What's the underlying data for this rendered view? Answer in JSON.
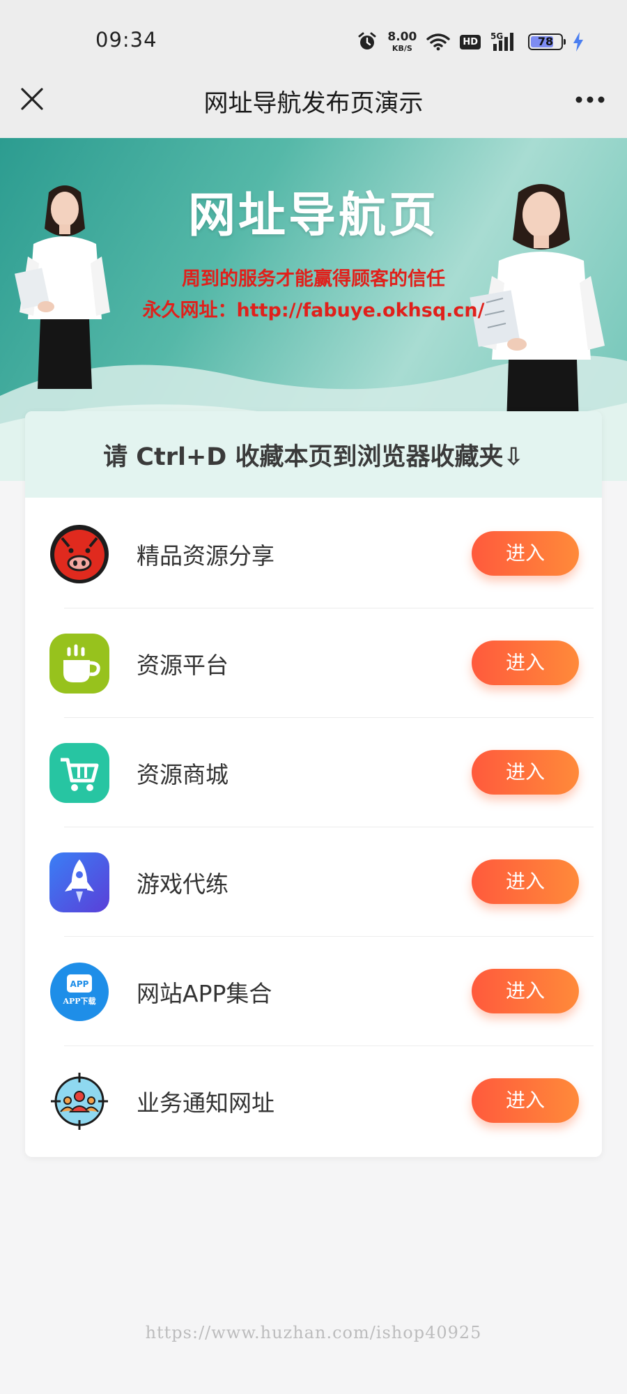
{
  "status_bar": {
    "time": "09:34",
    "net_speed_value": "8.00",
    "net_speed_unit": "KB/S",
    "hd_label": "HD",
    "signal_label": "5G",
    "battery_level": "78"
  },
  "nav": {
    "title": "网址导航发布页演示",
    "close_icon": "close-icon",
    "more_icon": "more-dots-icon"
  },
  "banner": {
    "title": "网址导航页",
    "line1": "周到的服务才能赢得顾客的信任",
    "line2": "永久网址：http://fabuye.okhsq.cn/"
  },
  "notice": "请 Ctrl+D 收藏本页到浏览器收藏夹⇩",
  "items": [
    {
      "label": "精品资源分享",
      "button": "进入",
      "icon": "pig-face-icon"
    },
    {
      "label": "资源平台",
      "button": "进入",
      "icon": "coffee-cup-icon"
    },
    {
      "label": "资源商城",
      "button": "进入",
      "icon": "shopping-cart-icon"
    },
    {
      "label": "游戏代练",
      "button": "进入",
      "icon": "rocket-icon"
    },
    {
      "label": "网站APP集合",
      "button": "进入",
      "icon": "app-download-icon",
      "icon_text_top": "APP",
      "icon_text_bottom": "APP下载"
    },
    {
      "label": "业务通知网址",
      "button": "进入",
      "icon": "target-group-icon"
    }
  ],
  "watermark": "https://www.huzhan.com/ishop40925",
  "colors": {
    "accent_button": "#ff6a3a",
    "banner_teal": "#55b8a8",
    "banner_red_text": "#e0201b"
  }
}
